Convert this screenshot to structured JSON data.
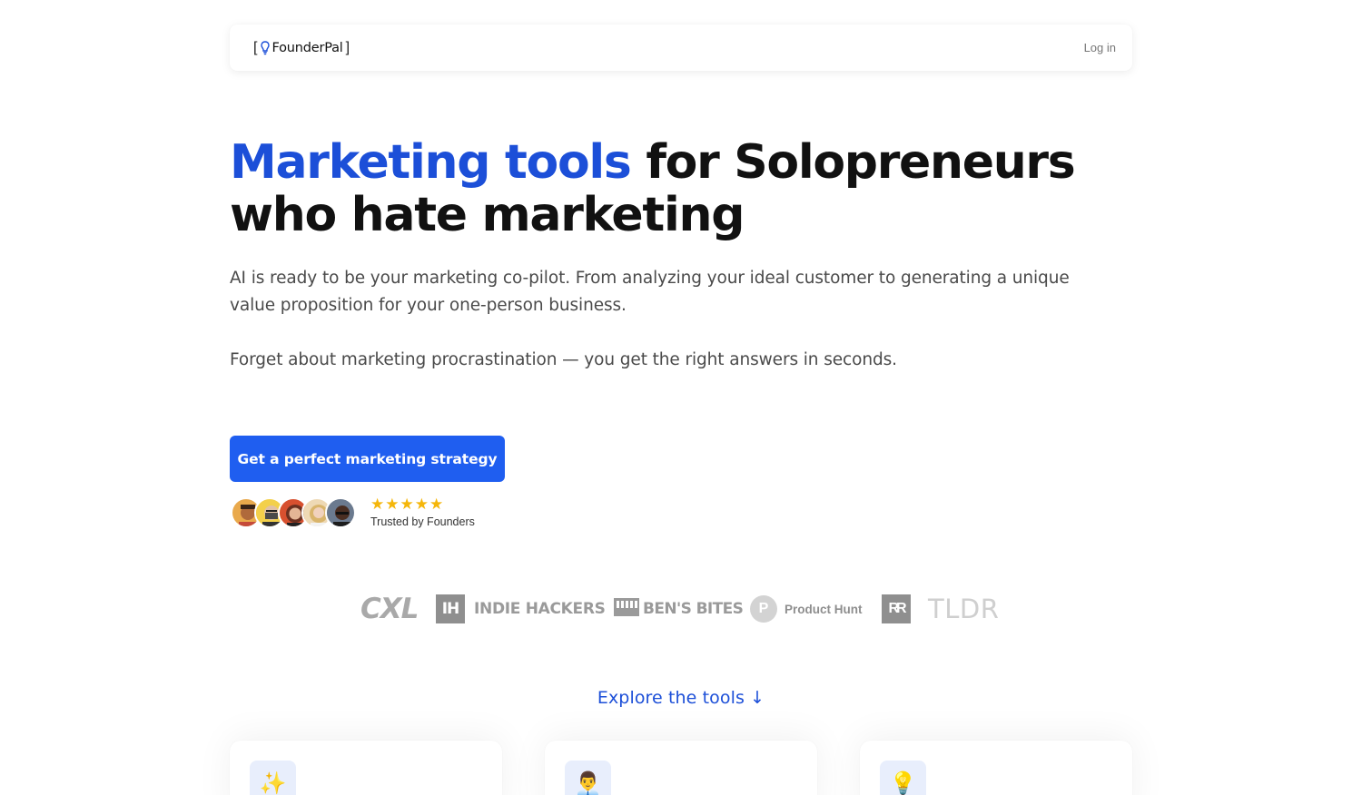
{
  "nav": {
    "logo_open": "[",
    "logo_name": "FounderPal",
    "logo_close": "]",
    "login_label": "Log in"
  },
  "hero": {
    "title_accent": "Marketing tools",
    "title_rest_line1": " for Solopreneurs",
    "title_line2": "who hate marketing",
    "lead": "AI is ready to be your marketing co-pilot. From analyzing your ideal customer to generating a unique value proposition for your one-person business.",
    "lead2": "Forget about marketing procrastination — you get the right answers in seconds.",
    "cta_label": "Get a perfect marketing strategy"
  },
  "social_proof": {
    "stars": "★★★★★",
    "rating": 5,
    "trusted_label": "Trusted by Founders",
    "avatar_count": 5
  },
  "logos": {
    "cxl": "CXL",
    "indie_hackers_mark": "IH",
    "indie_hackers": "INDIE HACKERS",
    "bens_bites": "BEN'S BITES",
    "product_hunt_mark": "P",
    "product_hunt": "Product Hunt",
    "rundown_mark": "RR",
    "tldr": "TLDR"
  },
  "explore": {
    "label": "Explore the tools ↓"
  },
  "cards": [
    {
      "icon": "sparkles-icon",
      "glyph": "✨"
    },
    {
      "icon": "person-icon",
      "glyph": "👨‍💼"
    },
    {
      "icon": "lightbulb-icon",
      "glyph": "💡"
    }
  ],
  "colors": {
    "accent": "#1c4fd8",
    "cta": "#1f5ef0",
    "star": "#f5b60a"
  }
}
